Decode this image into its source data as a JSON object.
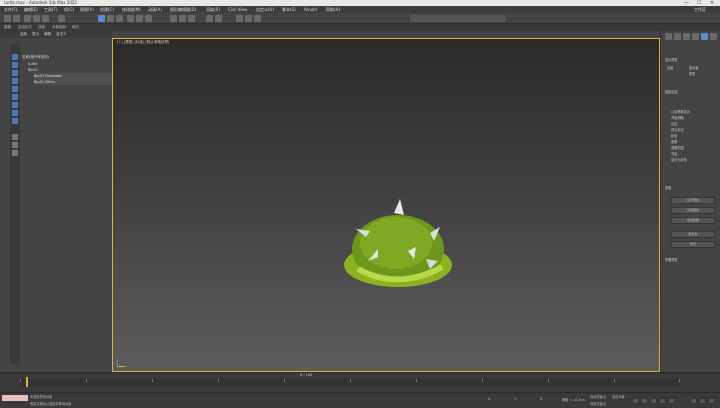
{
  "window": {
    "title": "turtle.max - Autodesk 3ds Max 2022",
    "controls": [
      "—",
      "☐",
      "✕"
    ],
    "workspace": "工作区"
  },
  "menubar": {
    "items": [
      "文件(F)",
      "编辑(E)",
      "工具(T)",
      "组(G)",
      "视图(V)",
      "创建(C)",
      "修改器(M)",
      "动画(A)",
      "图形编辑器(D)",
      "渲染(R)",
      "Civil View",
      "自定义(U)",
      "脚本(S)",
      "Arnold",
      "帮助(H)"
    ]
  },
  "toolbar2": {
    "items": [
      "建模",
      "自由形式",
      "选择",
      "对象绘制",
      "填充"
    ]
  },
  "left_panel": {
    "tabs": [
      "选择",
      "显示",
      "编辑",
      "自定义"
    ],
    "tree": [
      {
        "label": "名称(按升序排序)",
        "indent": 0
      },
      {
        "label": "turtle",
        "indent": 1
      },
      {
        "label": "Bip01",
        "indent": 1
      },
      {
        "label": "Bip01 Footsteps",
        "indent": 2
      },
      {
        "label": "Bip01 Pelvis",
        "indent": 2
      }
    ]
  },
  "viewport": {
    "label": "[+] [透视] [标准] [默认明暗处理]",
    "accent": "#d9b53a"
  },
  "command_panel": {
    "section1": "显示属性",
    "section2": "链接信息",
    "section3": "骨骼属性",
    "items": [
      "以边界框显示",
      "背面消隐",
      "仅边",
      "顶点标记",
      "轨迹",
      "透明",
      "忽略范围",
      "冻结",
      "显示为灰色"
    ],
    "buttons": [
      "显示属性",
      "渲染属性",
      "运动模糊",
      "按对象",
      "按层"
    ],
    "params": "参数",
    "opt_label": "启用",
    "opt_a": "按对象",
    "opt_b": "按层"
  },
  "timeline": {
    "frame": "0 / 100",
    "ticks": [
      "0",
      "10",
      "20",
      "30",
      "40",
      "50",
      "60",
      "70",
      "80",
      "90",
      "100"
    ]
  },
  "statusbar": {
    "selected": "未选定任何对象",
    "hint": "单击并拖动以选择并移动对象",
    "coords_x": "X:",
    "coords_y": "Y:",
    "coords_z": "Z:",
    "grid": "栅格 = 10.0cm",
    "autokey": "自动关键点",
    "setkey": "设置关键点",
    "mode": "选定对象"
  }
}
